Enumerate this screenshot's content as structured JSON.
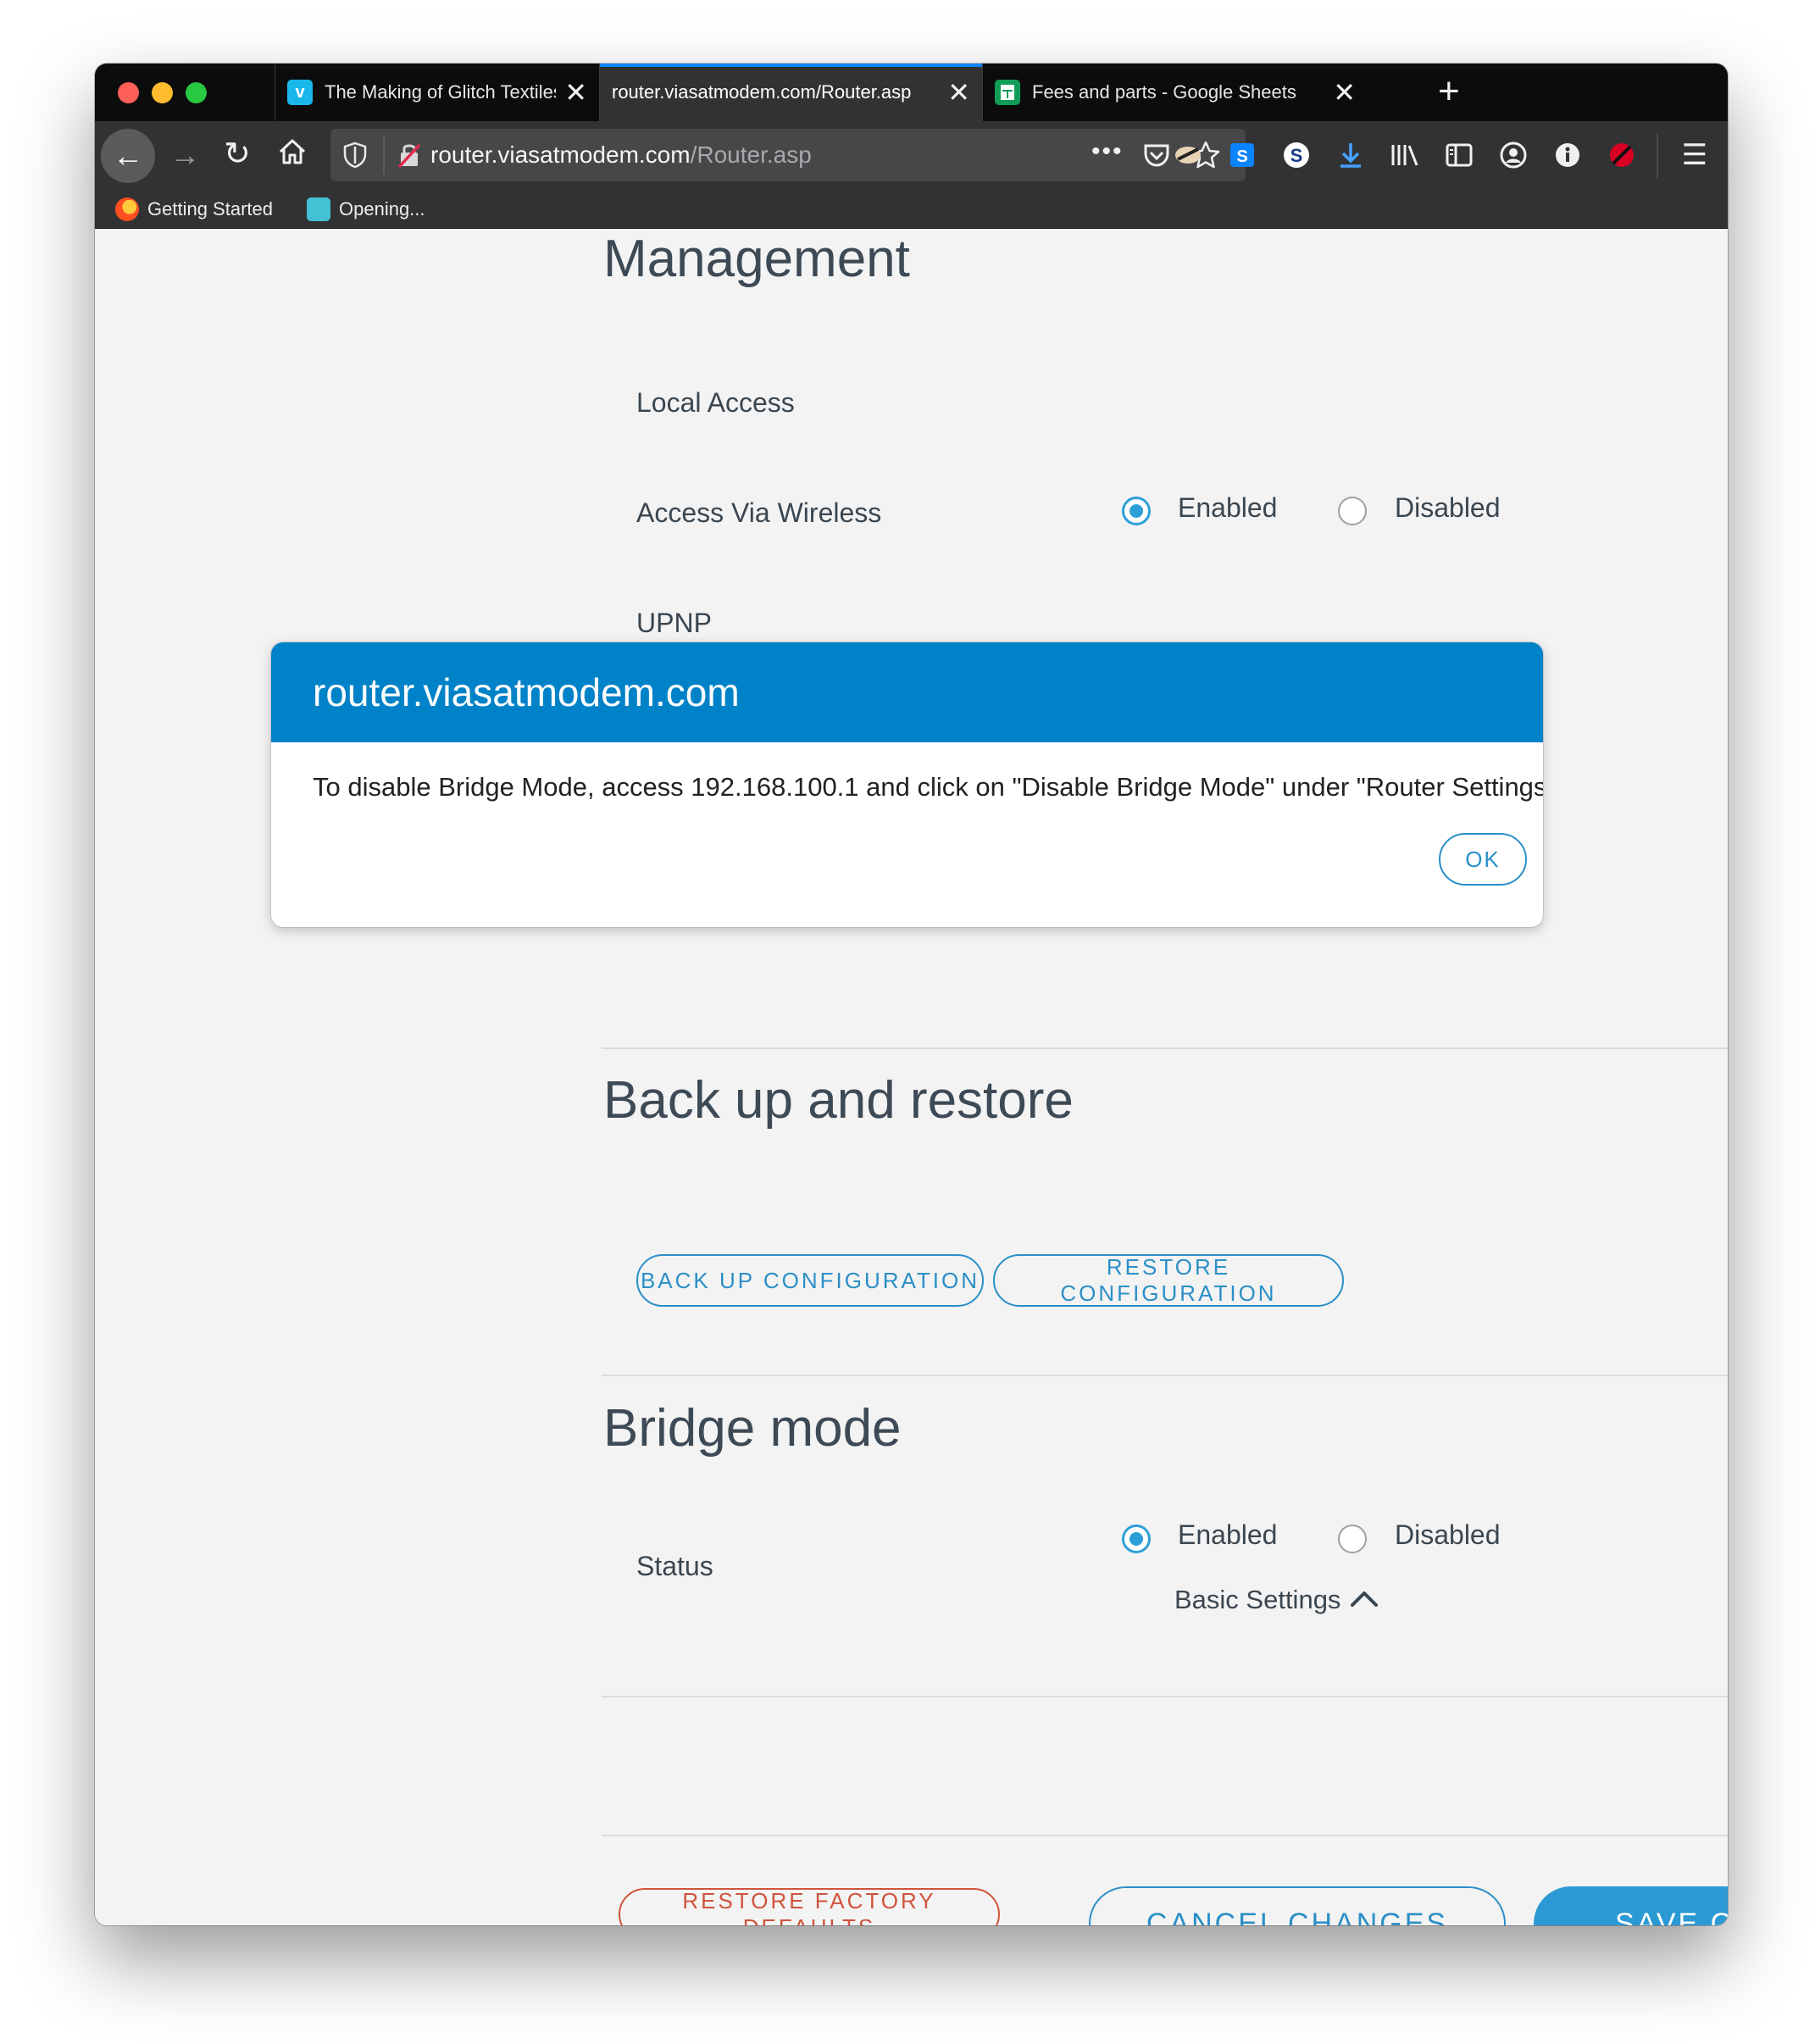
{
  "tabs": [
    {
      "title": "The Making of Glitch Textiles at",
      "favicon": "vimeo-icon",
      "favicon_letter": "v",
      "active": false
    },
    {
      "title": "router.viasatmodem.com/Router.asp",
      "favicon": "",
      "active": true
    },
    {
      "title": "Fees and parts - Google Sheets",
      "favicon": "google-sheets-icon",
      "active": false
    }
  ],
  "address_bar": {
    "host": "router.viasatmodem.com",
    "path": "/Router.asp"
  },
  "bookmarks": [
    {
      "label": "Getting Started",
      "icon": "firefox-icon"
    },
    {
      "label": "Opening...",
      "icon": "loading-icon"
    }
  ],
  "management": {
    "title": "Management",
    "local_access_label": "Local Access",
    "access_via_wireless_label": "Access Via Wireless",
    "access_via_wireless_value": "Enabled",
    "upnp_label": "UPNP",
    "enabled_label": "Enabled",
    "disabled_label": "Disabled"
  },
  "backup": {
    "title": "Back up and restore",
    "backup_button": "BACK UP CONFIGURATION",
    "restore_button": "RESTORE CONFIGURATION"
  },
  "bridge_mode": {
    "title": "Bridge mode",
    "status_label": "Status",
    "status_value": "Enabled",
    "enabled_label": "Enabled",
    "disabled_label": "Disabled"
  },
  "basic_settings_label": "Basic Settings",
  "footer": {
    "restore_defaults": "RESTORE FACTORY DEFAULTS",
    "cancel": "CANCEL CHANGES",
    "save": "SAVE CH"
  },
  "modal": {
    "title": "router.viasatmodem.com",
    "message": "To disable Bridge Mode, access 192.168.100.1 and click on \"Disable Bridge Mode\" under \"Router Settings\"",
    "ok_button": "OK"
  },
  "colors": {
    "accent": "#2b9ad4",
    "modal_header": "#0082c8",
    "danger": "#d0533b"
  }
}
